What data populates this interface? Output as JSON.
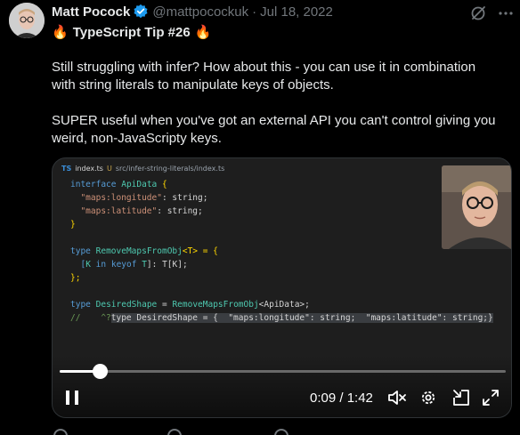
{
  "tweet": {
    "author_name": "Matt Pocock",
    "handle": "@mattpocockuk",
    "separator": "·",
    "date": "Jul 18, 2022",
    "title_emoji_left": "🔥",
    "title": "TypeScript Tip #26",
    "title_emoji_right": "🔥",
    "paragraph1_line1": "Still struggling with infer? How about this - you can use it in combination",
    "paragraph1_line2": "with string literals to manipulate keys of objects.",
    "paragraph2_line1": "SUPER useful when you've got an external API you can't control giving you",
    "paragraph2_line2": "weird, non-JavaScripty keys."
  },
  "icons": {
    "verified": "verified-badge-icon",
    "grok": "grok-icon",
    "more": "more-icon"
  },
  "video": {
    "editor_tab_lang": "TS",
    "editor_tab_file": "index.ts",
    "editor_tab_status": "U",
    "editor_tab_path": "src/infer-string-literals/index.ts",
    "time": "0:09 / 1:42",
    "progress_fraction": 0.09,
    "code": {
      "l1_kw": "interface",
      "l1_name": "ApiData",
      "l1_brace": "{",
      "l2_key": "\"maps:longitude\"",
      "l2_rest": ": string;",
      "l3_key": "\"maps:latitude\"",
      "l3_rest": ": string;",
      "l4_brace": "}",
      "l6_kw": "type",
      "l6_name": "RemoveMapsFromObj",
      "l6_rest": "<T> = {",
      "l7_open": "[",
      "l7_k": "K",
      "l7_in": "in",
      "l7_keyof": "keyof",
      "l7_t": "T",
      "l7_close": "]: T[K];",
      "l8_close": "};",
      "l10_kw": "type",
      "l10_name": "DesiredShape",
      "l10_eq": " = ",
      "l10_fn": "RemoveMapsFromObj",
      "l10_rest": "<ApiData>;",
      "l11_comment": "//    ^?",
      "l11_hover": "type DesiredShape = {  \"maps:longitude\": string;  \"maps:latitude\": string;}"
    }
  },
  "colors": {
    "background": "#000000",
    "text": "#e7e9ea",
    "muted": "#71767b",
    "verified": "#1d9bf0"
  }
}
